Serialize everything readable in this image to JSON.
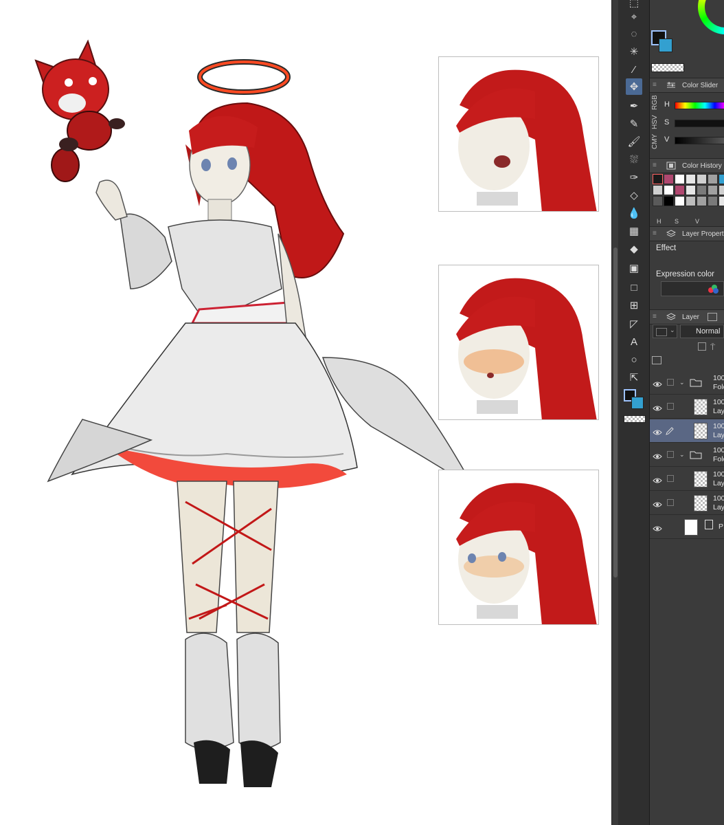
{
  "panels": {
    "color_slider": {
      "title": "Color Slider",
      "tabs": [
        "RGB",
        "HSV",
        "CMY"
      ],
      "labels": [
        "H",
        "S",
        "V"
      ]
    },
    "color_history": {
      "title": "Color History",
      "footer_letters": [
        "H",
        "S",
        "V"
      ]
    },
    "layer_property": {
      "title": "Layer Property",
      "effect_label": "Effect",
      "expression_color_label": "Expression color"
    },
    "layer": {
      "title": "Layer",
      "blend_mode": "Normal",
      "rows": [
        {
          "name_line1": "100",
          "name_line2": "Fold",
          "kind": "folder"
        },
        {
          "name_line1": "100",
          "name_line2": "Lay",
          "kind": "layer"
        },
        {
          "name_line1": "100",
          "name_line2": "Lay",
          "kind": "layer-selected"
        },
        {
          "name_line1": "100",
          "name_line2": "Fold",
          "kind": "folder"
        },
        {
          "name_line1": "100",
          "name_line2": "Lay",
          "kind": "layer"
        },
        {
          "name_line1": "100",
          "name_line2": "Lay",
          "kind": "layer"
        },
        {
          "name_line1": "P",
          "name_line2": "",
          "kind": "paper"
        }
      ]
    }
  },
  "tools": [
    "lasso-select-tool",
    "lasso-icon",
    "magic-wand-icon",
    "eyedropper-icon",
    "move-icon",
    "pen-icon",
    "pencil-icon",
    "brush-icon",
    "airbrush-icon",
    "decoration-icon",
    "eraser-icon",
    "blend-icon",
    "grid-icon",
    "fill-icon",
    "gradient-icon",
    "rectangle-icon",
    "frame-icon",
    "ruler-icon",
    "text-icon",
    "balloon-icon",
    "correct-line-icon"
  ],
  "colors": {
    "main": "#111111",
    "sub": "#33a0d0",
    "accent": "#4b6a95"
  },
  "color_history_swatches": [
    "#1a1a1a",
    "#b04870",
    "#ffffff",
    "#e6e6e6",
    "#cfcfcf",
    "#a0a0a0",
    "#33a0d0",
    "#cfcfcf",
    "#ffffff",
    "#b04870",
    "#e6e6e6",
    "#7a7a7a",
    "#a0a0a0",
    "#cfcfcf",
    "#5a5a5a",
    "#000000",
    "#ffffff",
    "#bdbdbd",
    "#a0a0a0",
    "#7a7a7a",
    "#e6e6e6"
  ]
}
